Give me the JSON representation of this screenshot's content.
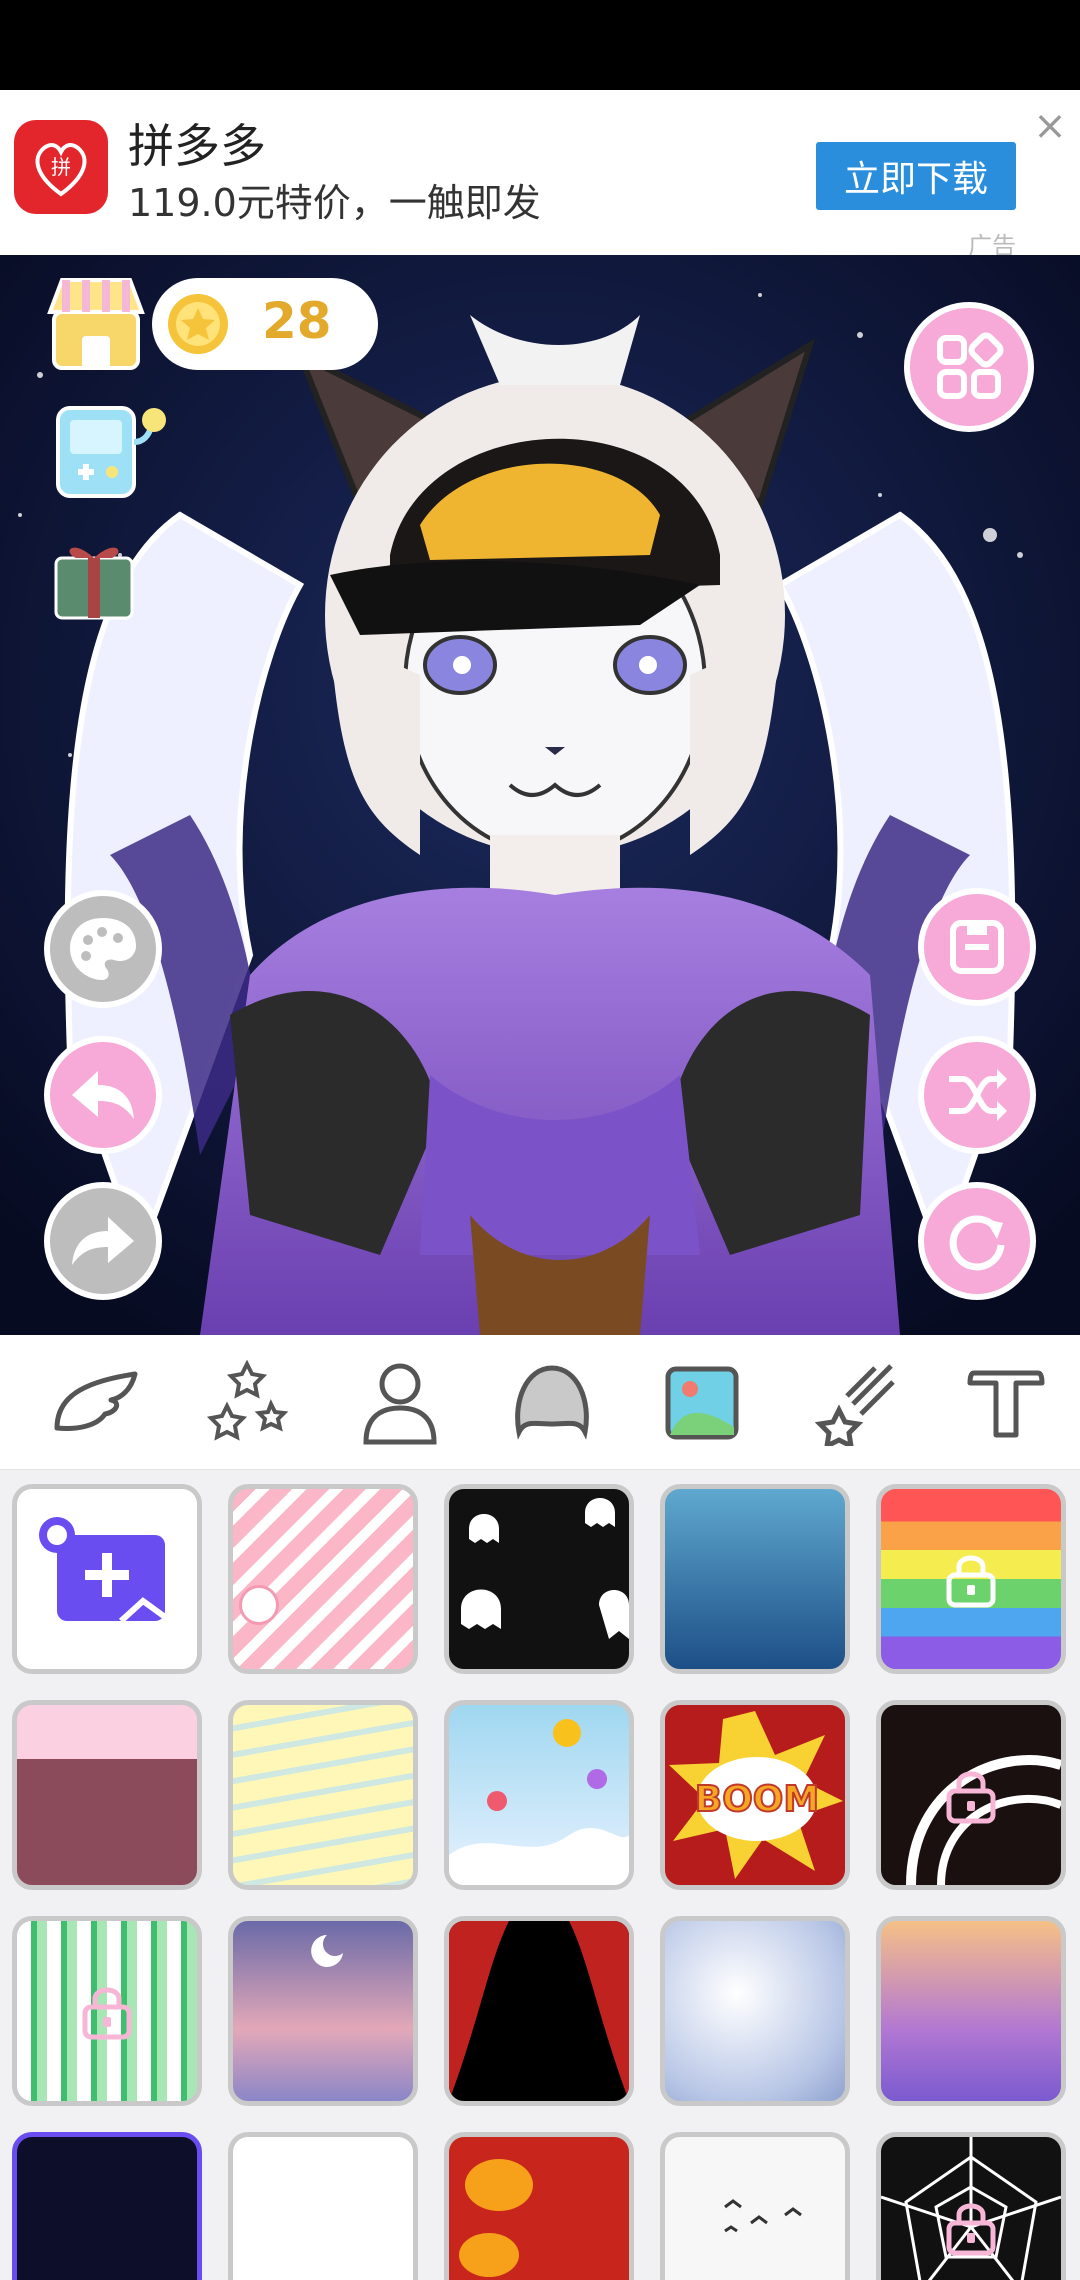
{
  "ad": {
    "title": "拼多多",
    "subtitle": "119.0元特价，一触即发",
    "button_label": "立即下载",
    "close_glyph": "×",
    "tag": "广告"
  },
  "header": {
    "coins": "28"
  },
  "colors": {
    "accent_pink": "#f7a9d7",
    "coin_text": "#e2a92a",
    "ad_button": "#2a8edd"
  },
  "categories": [
    {
      "icon": "wing-icon"
    },
    {
      "icon": "stars-icon"
    },
    {
      "icon": "person-icon"
    },
    {
      "icon": "head-icon"
    },
    {
      "icon": "background-image-icon",
      "selected": true
    },
    {
      "icon": "shooting-star-icon"
    },
    {
      "icon": "text-icon"
    }
  ],
  "backgrounds": [
    {
      "name": "add-custom-background",
      "locked": false
    },
    {
      "name": "pink-stripes",
      "locked": false
    },
    {
      "name": "ghosts",
      "locked": false
    },
    {
      "name": "underwater",
      "locked": false
    },
    {
      "name": "rainbow",
      "locked": true
    },
    {
      "name": "pink-forest",
      "locked": false
    },
    {
      "name": "yellow-waves",
      "locked": false
    },
    {
      "name": "balloon-sky",
      "locked": false
    },
    {
      "name": "boom",
      "locked": false
    },
    {
      "name": "swirl",
      "locked": true
    },
    {
      "name": "bamboo",
      "locked": true
    },
    {
      "name": "night-clouds",
      "locked": false
    },
    {
      "name": "stage-curtains",
      "locked": false
    },
    {
      "name": "bokeh",
      "locked": false
    },
    {
      "name": "purple-sparkle",
      "locked": false
    },
    {
      "name": "starry-night",
      "locked": false
    },
    {
      "name": "plain-white",
      "locked": false
    },
    {
      "name": "lanterns",
      "locked": false
    },
    {
      "name": "birds",
      "locked": false
    },
    {
      "name": "spider-web",
      "locked": true
    }
  ],
  "background_labels": {
    "boom": "BOOM"
  }
}
